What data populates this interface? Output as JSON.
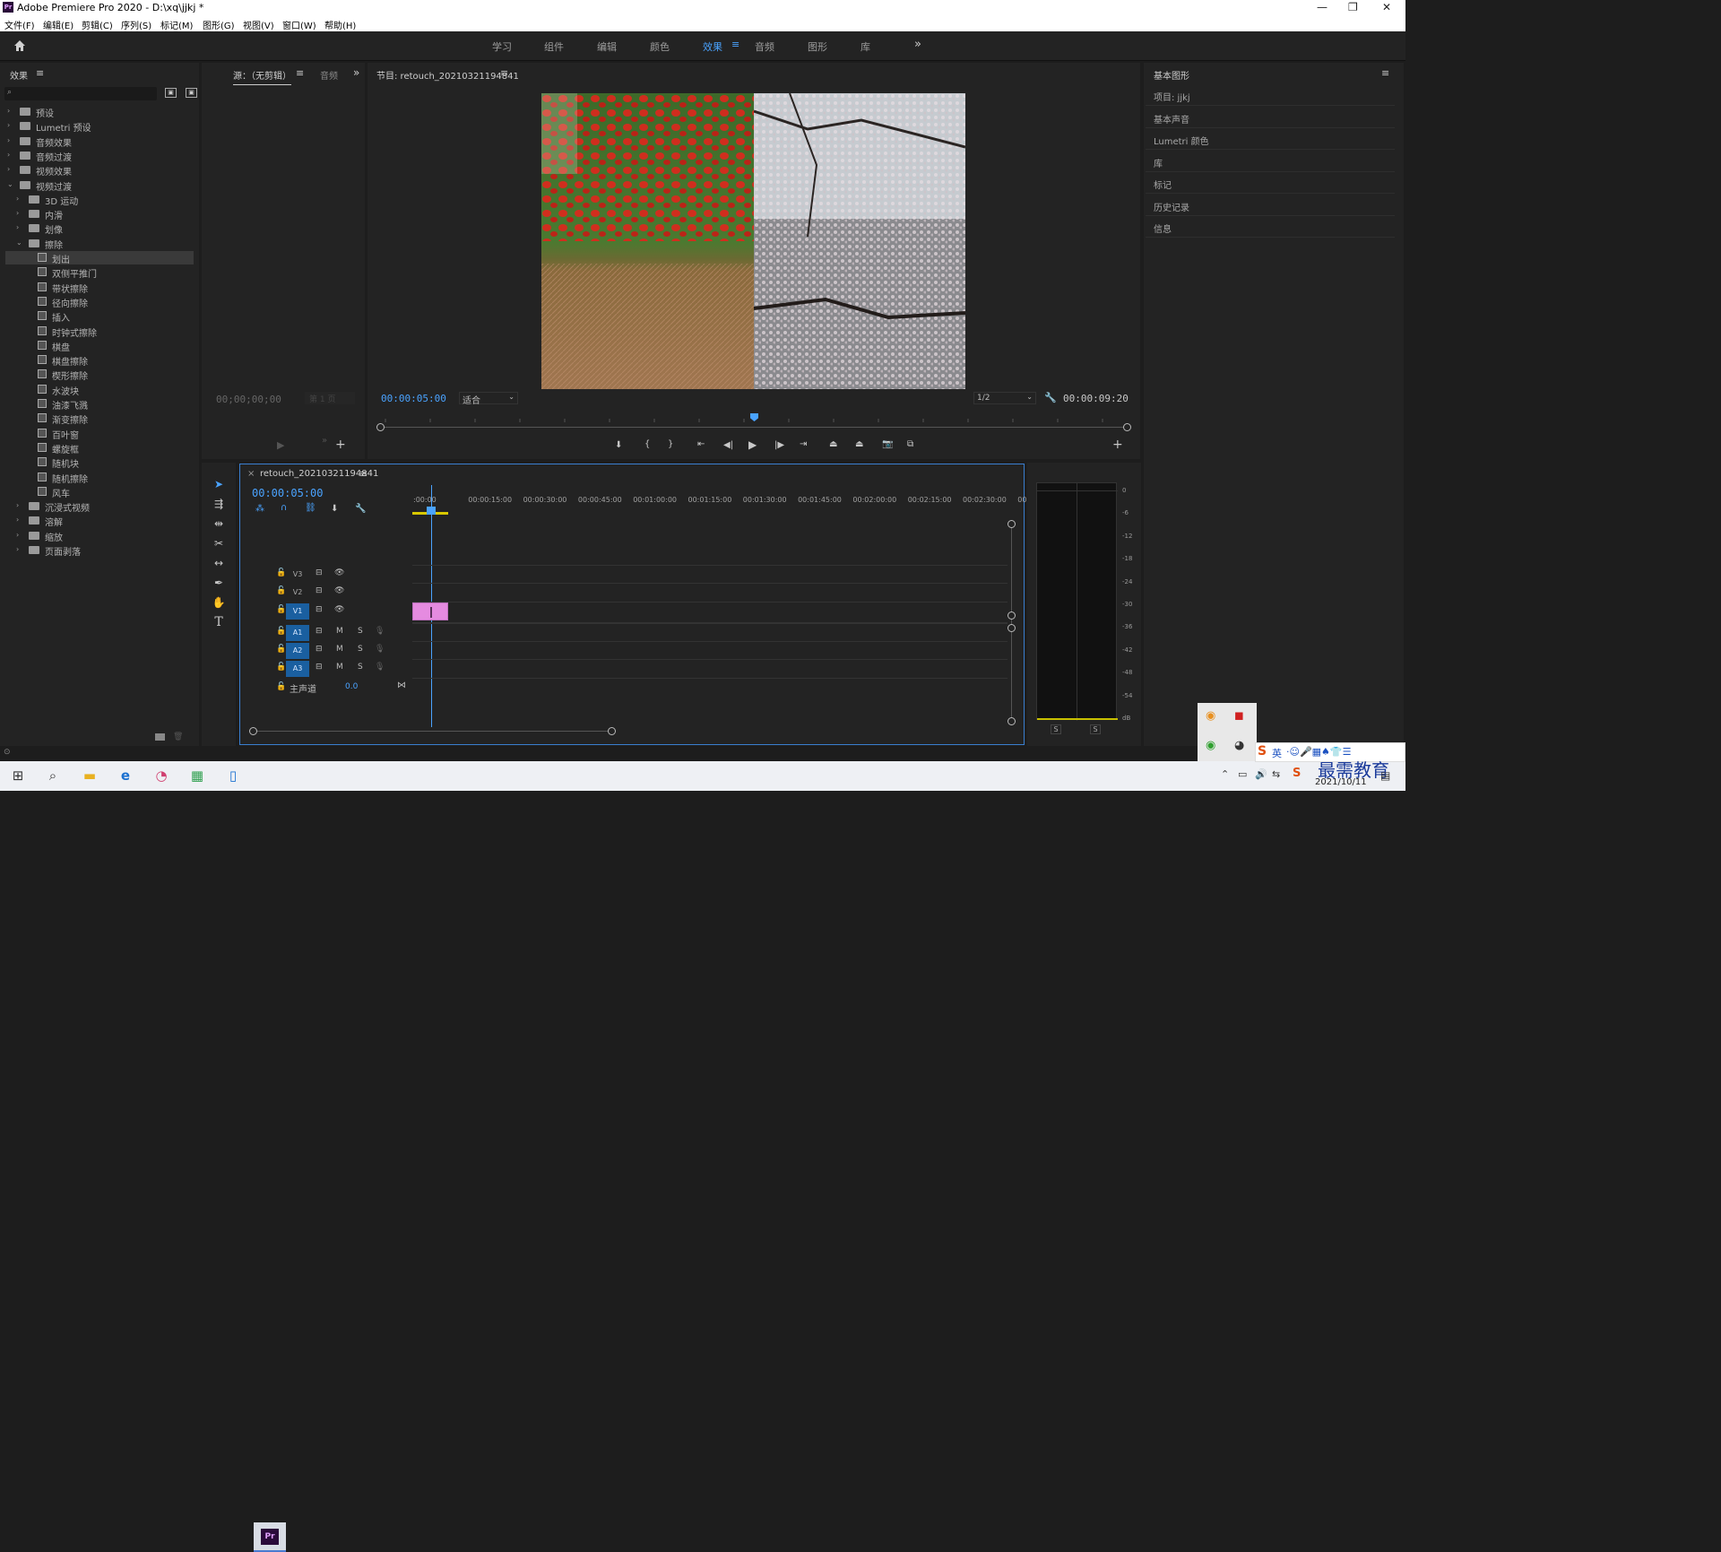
{
  "app": {
    "title": "Adobe Premiere Pro 2020 - D:\\xq\\jjkj *",
    "logo": "Pr"
  },
  "window_controls": [
    "—",
    "❐",
    "✕"
  ],
  "menu": [
    "文件(F)",
    "编辑(E)",
    "剪辑(C)",
    "序列(S)",
    "标记(M)",
    "图形(G)",
    "视图(V)",
    "窗口(W)",
    "帮助(H)"
  ],
  "workspaces": {
    "tabs": [
      "学习",
      "组件",
      "编辑",
      "颜色",
      "效果",
      "音频",
      "图形",
      "库"
    ],
    "active": "效果",
    "more": "»"
  },
  "effects_panel": {
    "title": "效果",
    "items": [
      {
        "label": "预设",
        "depth": 0,
        "type": "folder-bin",
        "open": false
      },
      {
        "label": "Lumetri 预设",
        "depth": 0,
        "type": "folder-bin",
        "open": false
      },
      {
        "label": "音频效果",
        "depth": 0,
        "type": "folder",
        "open": false
      },
      {
        "label": "音频过渡",
        "depth": 0,
        "type": "folder",
        "open": false
      },
      {
        "label": "视频效果",
        "depth": 0,
        "type": "folder",
        "open": false
      },
      {
        "label": "视频过渡",
        "depth": 0,
        "type": "folder",
        "open": true
      },
      {
        "label": "3D 运动",
        "depth": 1,
        "type": "folder",
        "open": false
      },
      {
        "label": "内滑",
        "depth": 1,
        "type": "folder",
        "open": false
      },
      {
        "label": "划像",
        "depth": 1,
        "type": "folder",
        "open": false
      },
      {
        "label": "擦除",
        "depth": 1,
        "type": "folder",
        "open": true
      },
      {
        "label": "划出",
        "depth": 2,
        "type": "fx",
        "selected": true
      },
      {
        "label": "双侧平推门",
        "depth": 2,
        "type": "fx"
      },
      {
        "label": "带状擦除",
        "depth": 2,
        "type": "fx"
      },
      {
        "label": "径向擦除",
        "depth": 2,
        "type": "fx"
      },
      {
        "label": "插入",
        "depth": 2,
        "type": "fx"
      },
      {
        "label": "时钟式擦除",
        "depth": 2,
        "type": "fx"
      },
      {
        "label": "棋盘",
        "depth": 2,
        "type": "fx"
      },
      {
        "label": "棋盘擦除",
        "depth": 2,
        "type": "fx"
      },
      {
        "label": "楔形擦除",
        "depth": 2,
        "type": "fx"
      },
      {
        "label": "水波块",
        "depth": 2,
        "type": "fx"
      },
      {
        "label": "油漆飞溅",
        "depth": 2,
        "type": "fx"
      },
      {
        "label": "渐变擦除",
        "depth": 2,
        "type": "fx"
      },
      {
        "label": "百叶窗",
        "depth": 2,
        "type": "fx"
      },
      {
        "label": "螺旋框",
        "depth": 2,
        "type": "fx"
      },
      {
        "label": "随机块",
        "depth": 2,
        "type": "fx"
      },
      {
        "label": "随机擦除",
        "depth": 2,
        "type": "fx"
      },
      {
        "label": "风车",
        "depth": 2,
        "type": "fx"
      },
      {
        "label": "沉浸式视频",
        "depth": 1,
        "type": "folder",
        "open": false
      },
      {
        "label": "溶解",
        "depth": 1,
        "type": "folder",
        "open": false
      },
      {
        "label": "缩放",
        "depth": 1,
        "type": "folder",
        "open": false
      },
      {
        "label": "页面剥落",
        "depth": 1,
        "type": "folder",
        "open": false
      }
    ]
  },
  "source_panel": {
    "tab": "源：（无剪辑）",
    "tab2": "音频",
    "timecode": "00;00;00;00",
    "page": "第 1 页"
  },
  "program_panel": {
    "title": "节目: retouch_20210321194841",
    "timecode": "00:00:05:00",
    "fit": "适合",
    "resolution": "1/2",
    "duration": "00:00:09:20",
    "playhead_frac": 0.5
  },
  "timeline": {
    "title": "retouch_20210321194841",
    "timecode": "00:00:05:00",
    "ruler": [
      ":00:00",
      "00:00:15:00",
      "00:00:30:00",
      "00:00:45:00",
      "00:01:00:00",
      "00:01:15:00",
      "00:01:30:00",
      "00:01:45:00",
      "00:02:00:00",
      "00:02:15:00",
      "00:02:30:00",
      "00:"
    ],
    "video_tracks": [
      "V3",
      "V2",
      "V1"
    ],
    "audio_tracks": [
      "A1",
      "A2",
      "A3"
    ],
    "master": {
      "label": "主声道",
      "value": "0.0"
    },
    "mute": "M",
    "solo": "S"
  },
  "meter": {
    "labels": [
      "0",
      "-6",
      "-12",
      "-18",
      "-24",
      "-30",
      "-36",
      "-42",
      "-48",
      "-54",
      "dB"
    ],
    "solo": [
      "S",
      "S"
    ]
  },
  "right_panel": {
    "title": "基本图形",
    "items": [
      "项目: jjkj",
      "基本声音",
      "Lumetri 颜色",
      "库",
      "标记",
      "历史记录",
      "信息"
    ]
  },
  "taskbar": {
    "date": "2021/10/11",
    "ime": "英",
    "watermark": "最需教育"
  },
  "colors": {
    "accent": "#4aa3ff",
    "clip": "#e58be0",
    "track_on": "#1a5fa0"
  }
}
